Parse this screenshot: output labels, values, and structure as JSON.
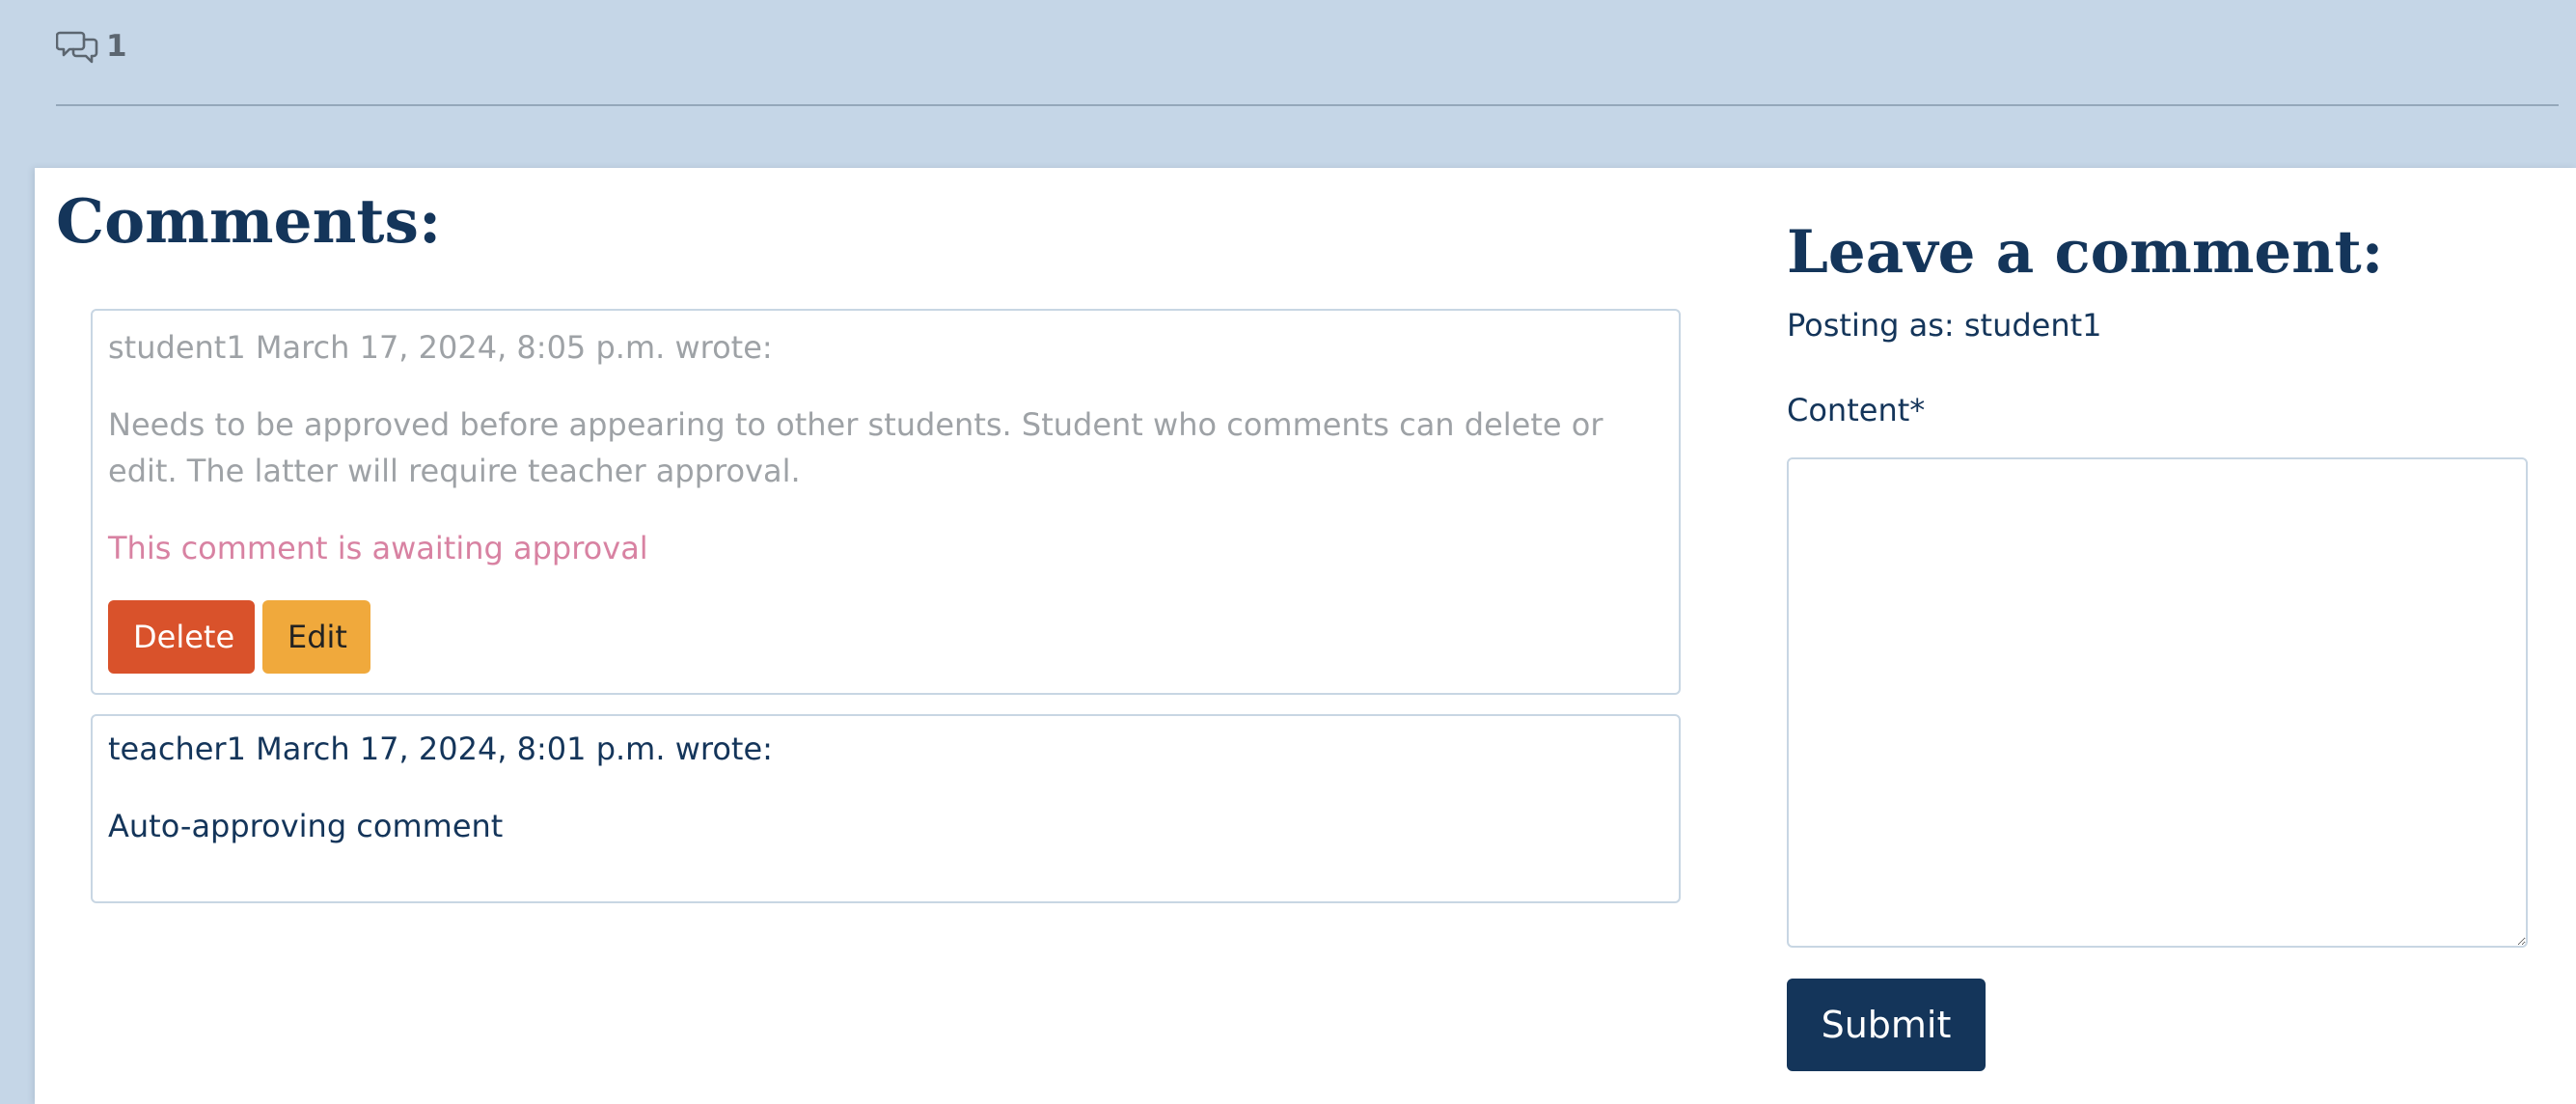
{
  "header": {
    "comment_count": "1",
    "comment_icon": "chat-bubbles-icon"
  },
  "comments_section": {
    "title": "Comments:",
    "items": [
      {
        "meta": "student1 March 17, 2024, 8:05 p.m. wrote:",
        "body": "Needs to be approved before appearing to other students. Student who comments can delete or edit. The latter will require teacher approval.",
        "status": "This comment is awaiting approval",
        "delete_label": "Delete",
        "edit_label": "Edit"
      },
      {
        "meta": "teacher1 March 17, 2024, 8:01 p.m. wrote:",
        "body": "Auto-approving comment"
      }
    ]
  },
  "form": {
    "title": "Leave a comment:",
    "posting_as": "Posting as: student1",
    "content_label": "Content*",
    "content_value": "",
    "submit_label": "Submit"
  },
  "colors": {
    "background": "#c5d6e7",
    "primary": "#14355a",
    "delete": "#d9522b",
    "edit": "#f0a93c",
    "awaiting": "#d882a2"
  }
}
